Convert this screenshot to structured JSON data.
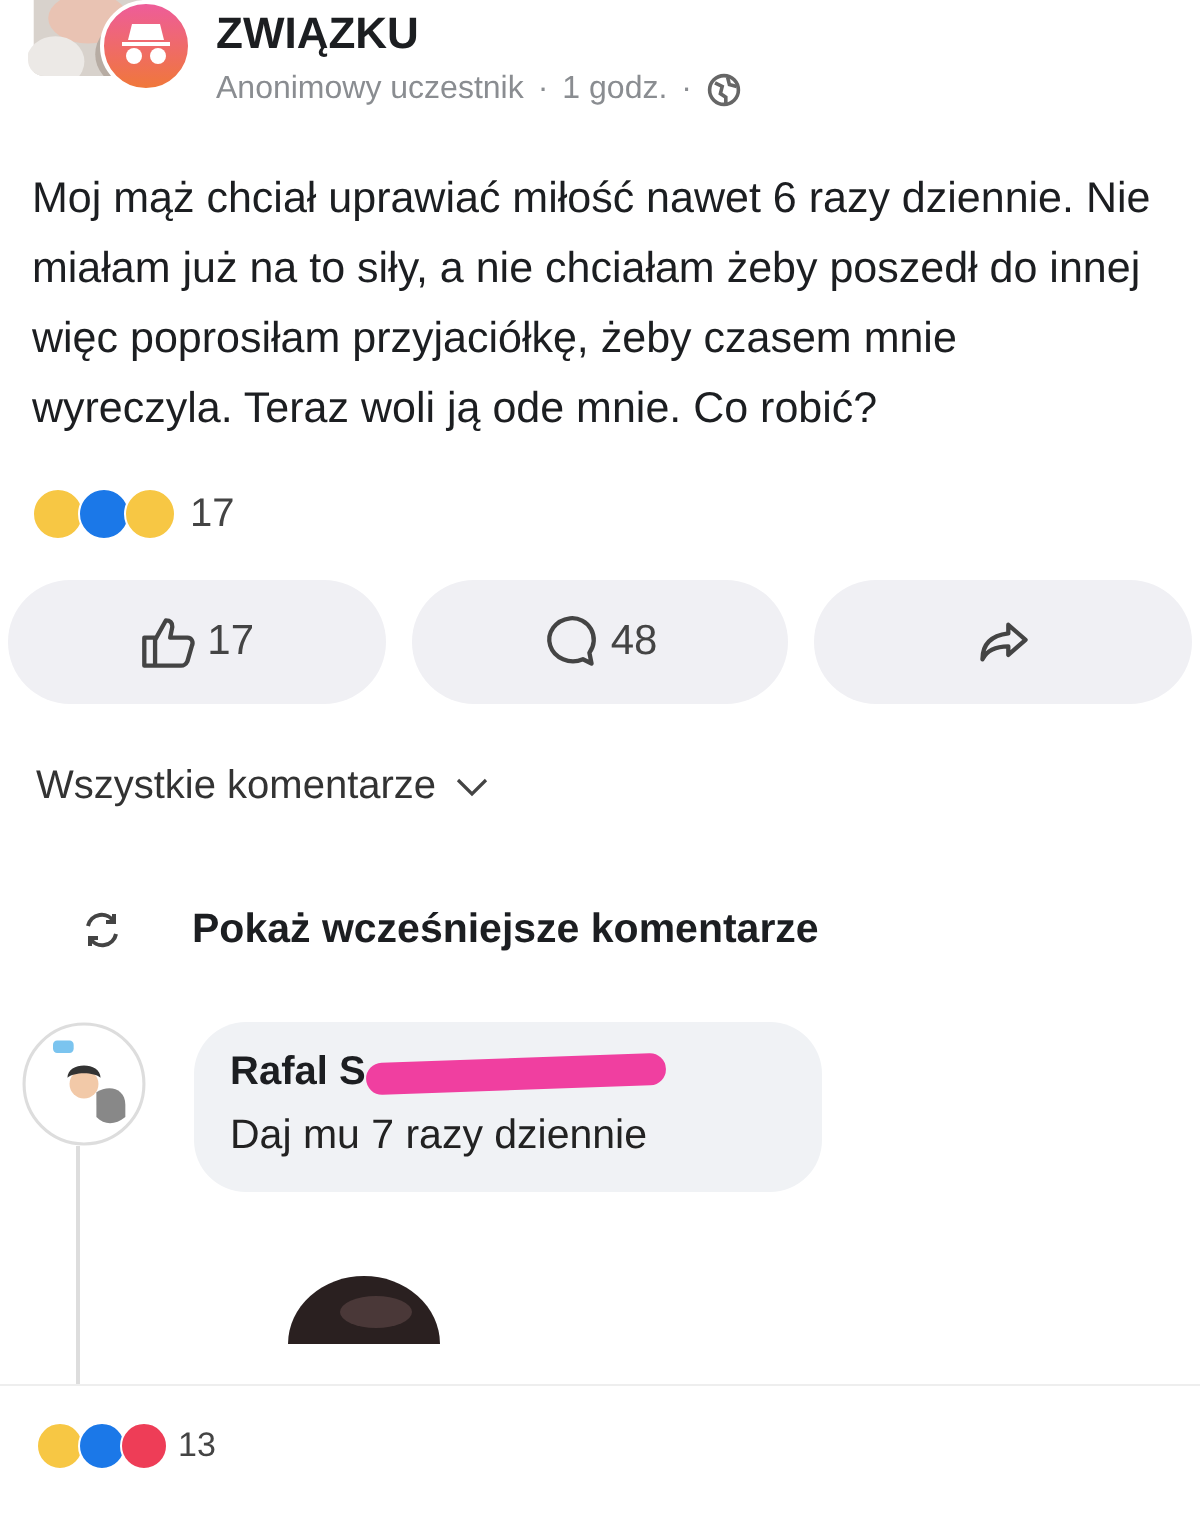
{
  "post": {
    "group": "ZWIĄZKU",
    "author": "Anonimowy uczestnik",
    "time": "1 godz.",
    "separator": "·",
    "text": "Moj mąż chciał uprawiać miłość nawet 6 razy dziennie. Nie miałam już na to siły, a nie chciałam żeby poszedł do innej więc poprosiłam przyjaciółkę, żeby czasem mnie wyreczyla. Teraz woli ją ode mnie. Co robić?"
  },
  "reactions": {
    "items": [
      {
        "kind": "haha"
      },
      {
        "kind": "like"
      },
      {
        "kind": "wow"
      }
    ],
    "count": "17"
  },
  "actions": [
    {
      "kind": "like",
      "label": "17"
    },
    {
      "kind": "comment",
      "label": "48"
    },
    {
      "kind": "share"
    }
  ],
  "comments_filter": "Wszystkie komentarze",
  "show_earlier": "Pokaż wcześniejsze komentarze",
  "comment": {
    "author": "Rafal S",
    "text": "Daj mu 7 razy dziennie"
  },
  "bottom_reactions": {
    "items": [
      {
        "kind": "haha"
      },
      {
        "kind": "like"
      },
      {
        "kind": "love"
      }
    ],
    "count": "13"
  }
}
